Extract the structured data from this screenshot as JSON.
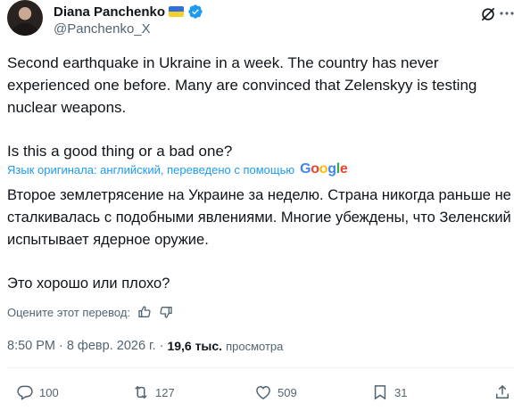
{
  "author": {
    "name": "Diana Panchenko",
    "handle": "@Panchenko_X"
  },
  "tweet": {
    "text_en_p1": "Second earthquake in Ukraine in a week. The country has never experienced one before. Many are convinced that Zelenskyy is testing nuclear weapons.",
    "text_en_p2": "Is this a good thing or a bad one?",
    "translation_label": "Язык оригинала: английский, переведено с помощью",
    "translation_provider": "Google",
    "text_ru_p1": "Второе землетрясение на Украине за неделю. Страна никогда раньше не сталкивалась с подобными явлениями. Многие убеждены, что Зеленский испытывает ядерное оружие.",
    "text_ru_p2": "Это хорошо или плохо?",
    "rate_label": "Оцените этот перевод:"
  },
  "meta": {
    "time": "8:50 PM",
    "separator": "·",
    "date": "8 февр. 2026 г.",
    "separator2": "·",
    "views_count": "19,6 тыс.",
    "views_label": "просмотра"
  },
  "actions": {
    "replies": "100",
    "reposts": "127",
    "likes": "509",
    "bookmarks": "31"
  },
  "colors": {
    "accent": "#1d9bf0",
    "secondary_text": "#536471",
    "primary_text": "#0f1419"
  },
  "icons": [
    "grok-icon",
    "more-icon",
    "verified-badge-icon",
    "ukraine-flag-icon",
    "thumbs-up-icon",
    "thumbs-down-icon",
    "reply-icon",
    "repost-icon",
    "like-icon",
    "bookmark-icon",
    "share-icon"
  ]
}
